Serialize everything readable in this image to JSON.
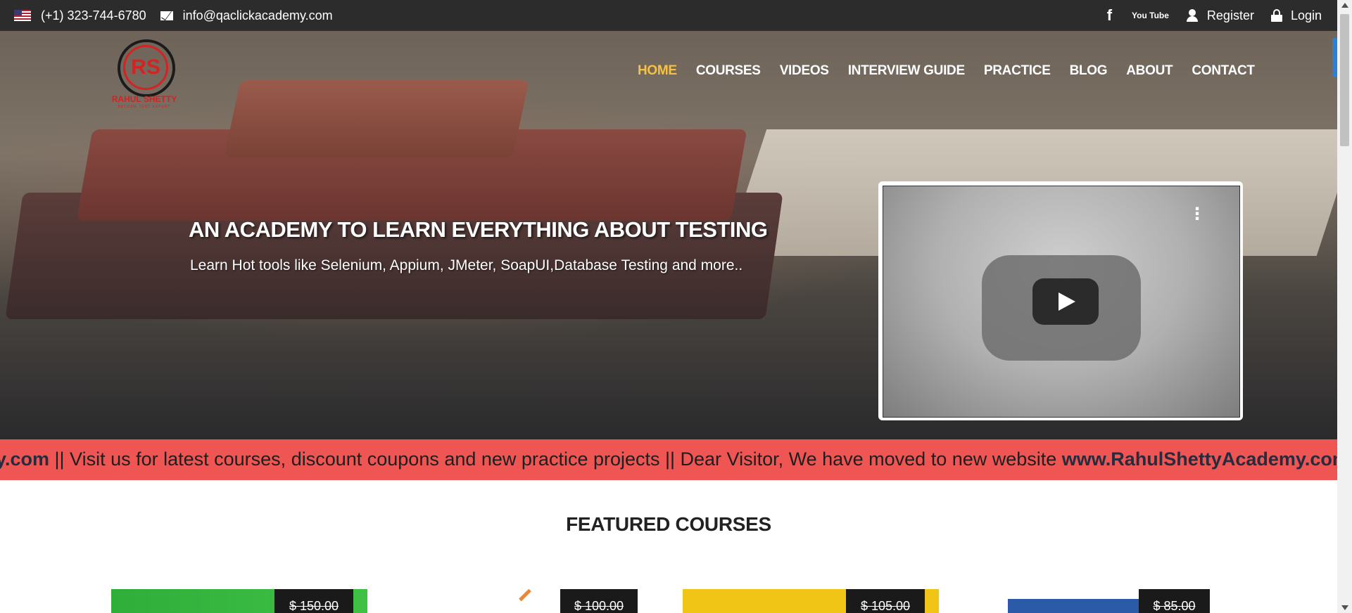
{
  "topbar": {
    "phone": "(+1) 323-744-6780",
    "email": "info@qaclickacademy.com",
    "facebook_glyph": "f",
    "youtube_glyph": "You Tube",
    "register": "Register",
    "login": "Login"
  },
  "logo": {
    "monogram": "RS",
    "brand": "RAHUL SHETTY",
    "tagline": "BECOME TEST EXPERT"
  },
  "nav": {
    "items": [
      "HOME",
      "COURSES",
      "VIDEOS",
      "INTERVIEW GUIDE",
      "PRACTICE",
      "BLOG",
      "ABOUT",
      "CONTACT"
    ],
    "active": "HOME",
    "active_color": "#f7c143"
  },
  "hero": {
    "title": "AN ACADEMY TO LEARN EVERYTHING ABOUT TESTING",
    "subtitle": "Learn Hot tools like Selenium, Appium, JMeter, SoapUI,Database Testing and more.."
  },
  "video": {
    "menu_glyph": "⋮"
  },
  "ticker": {
    "lead": "y.com",
    "text": " || Visit us for latest courses, discount coupons and new practice projects || Dear Visitor, We have moved to new website ",
    "link": "www.RahulShettyAcademy.com",
    "background": "#ef5553"
  },
  "featured": {
    "title": "FEATURED COURSES",
    "prices": [
      "$ 150.00",
      "$ 100.00",
      "$ 105.00",
      "$ 85.00"
    ]
  }
}
